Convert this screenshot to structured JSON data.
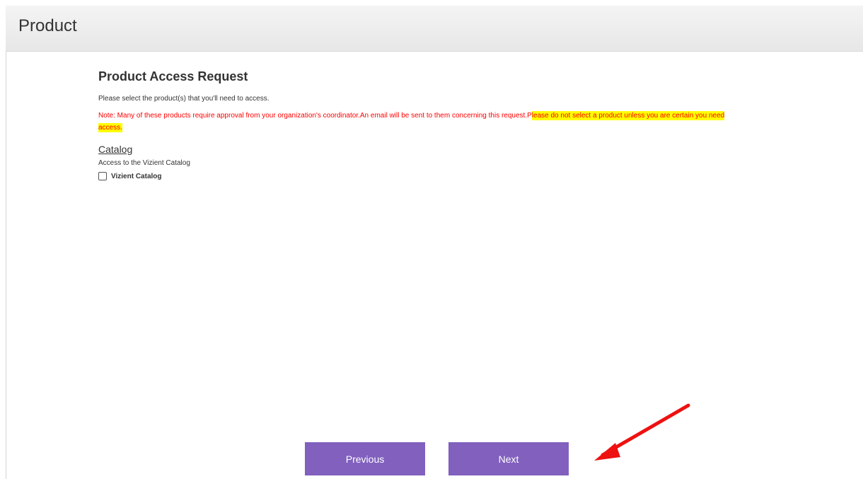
{
  "header": {
    "title": "Product"
  },
  "main": {
    "heading": "Product Access Request",
    "intro": "Please select the product(s) that you'll need to access.",
    "note_plain": "Note: Many of these products require approval from your organization's coordinator.An email will be sent to them concerning this request.P",
    "note_highlight_1": "lease do not select a product unless you are certain you need",
    "note_highlight_2": "access.",
    "section": {
      "title": "Catalog",
      "description": "Access to the Vizient Catalog",
      "option_label": "Vizient Catalog",
      "option_checked": false
    }
  },
  "buttons": {
    "previous": "Previous",
    "next": "Next"
  },
  "colors": {
    "button_bg": "#8160be",
    "note_text": "#ff0000",
    "highlight": "#ffff00",
    "annotation_arrow": "#ee1111"
  }
}
